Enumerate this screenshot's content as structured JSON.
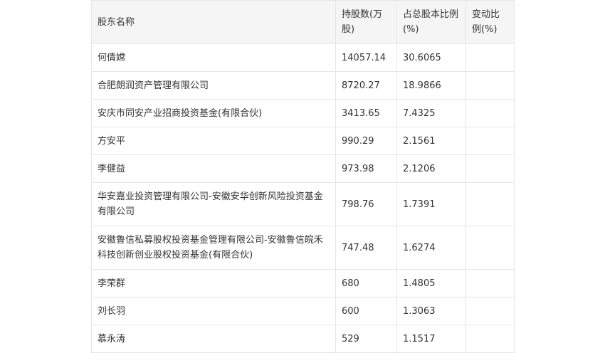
{
  "table": {
    "headers": [
      "股东名称",
      "持股数(万股)",
      "占总股本比例(%)",
      "变动比例(%)"
    ],
    "rows": [
      [
        "何倩嫦",
        "14057.14",
        "30.6065",
        ""
      ],
      [
        "合肥朗润资产管理有限公司",
        "8720.27",
        "18.9866",
        ""
      ],
      [
        "安庆市同安产业招商投资基金(有限合伙)",
        "3413.65",
        "7.4325",
        ""
      ],
      [
        "方安平",
        "990.29",
        "2.1561",
        ""
      ],
      [
        "李健益",
        "973.98",
        "2.1206",
        ""
      ],
      [
        "华安嘉业投资管理有限公司-安徽安华创新风险投资基金有限公司",
        "798.76",
        "1.7391",
        ""
      ],
      [
        "安徽鲁信私募股权投资基金管理有限公司-安徽鲁信皖禾科技创新创业股权投资基金(有限合伙)",
        "747.48",
        "1.6274",
        ""
      ],
      [
        "李荣群",
        "680",
        "1.4805",
        ""
      ],
      [
        "刘长羽",
        "600",
        "1.3063",
        ""
      ],
      [
        "慕永涛",
        "529",
        "1.1517",
        ""
      ]
    ]
  }
}
